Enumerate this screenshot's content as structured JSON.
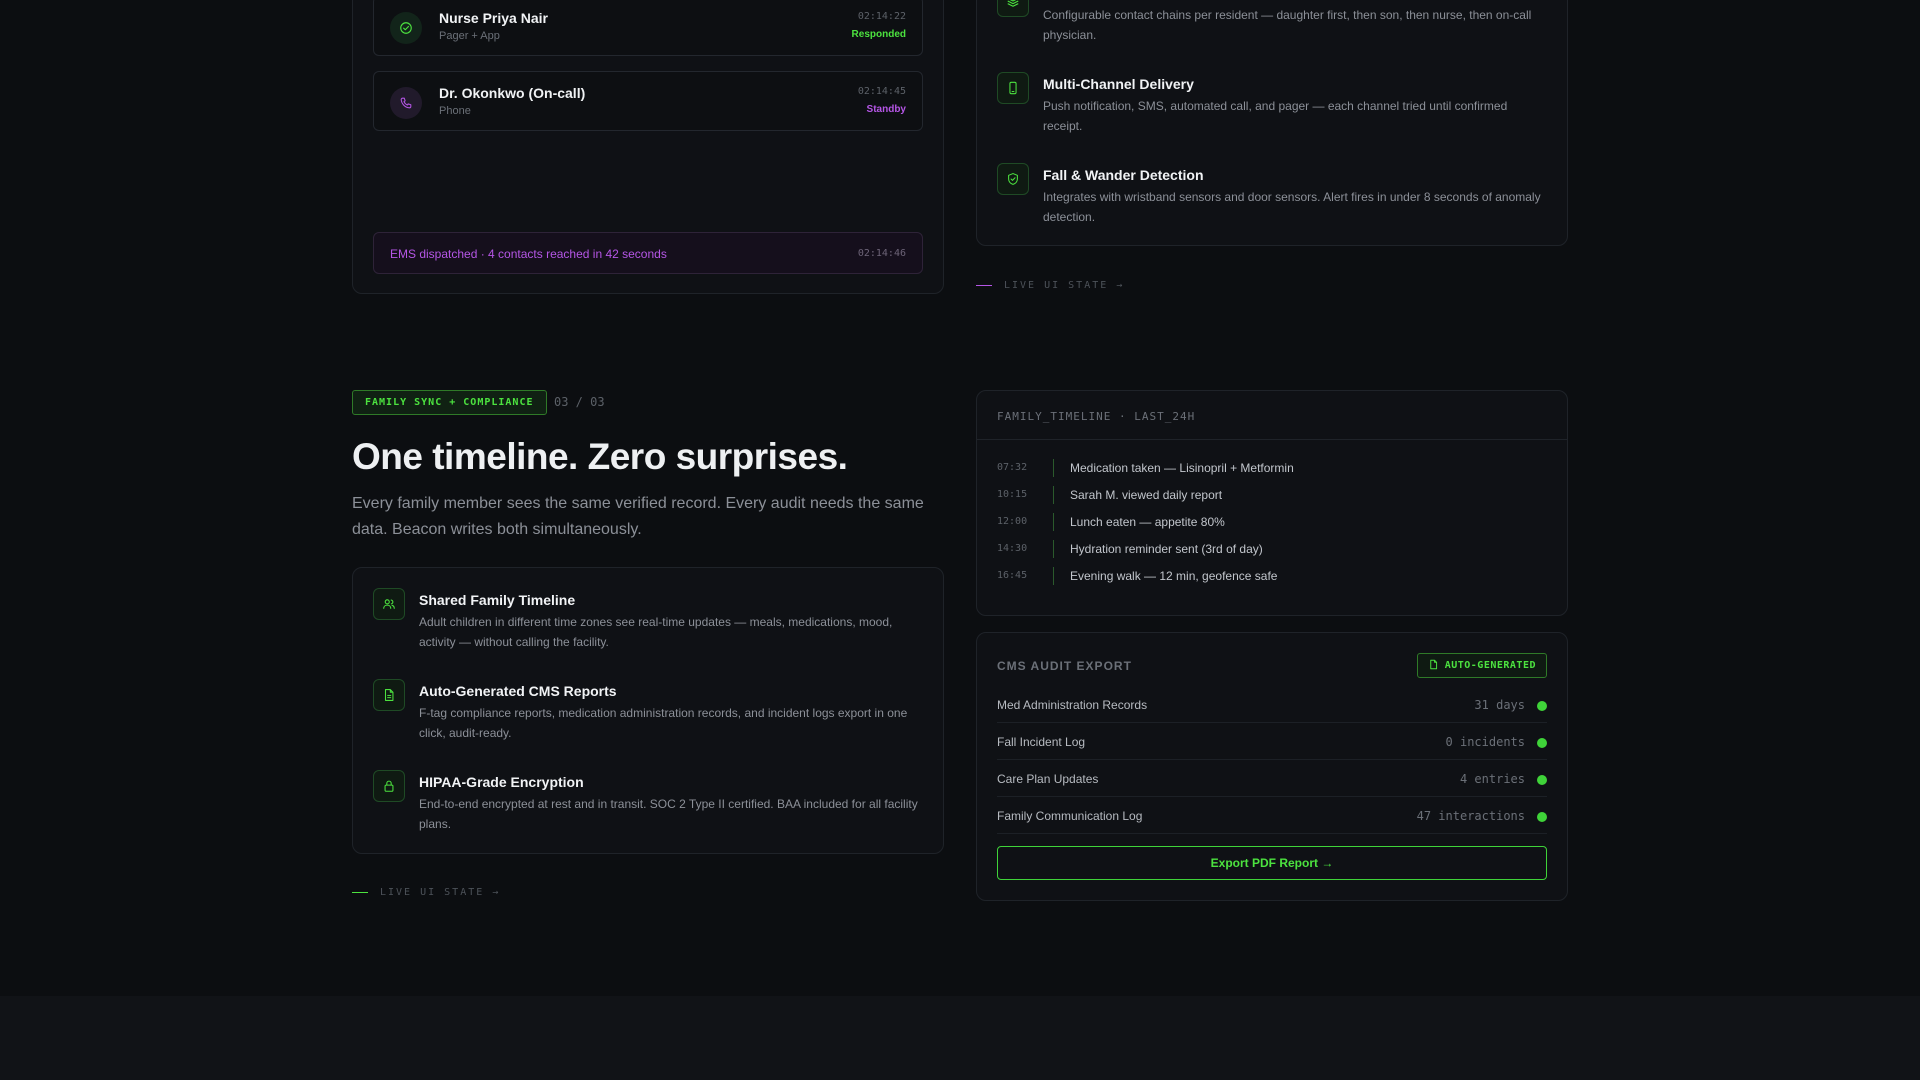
{
  "colors": {
    "accent_green": "#4ce23f",
    "accent_purple": "#b556e6",
    "background": "#0c0e11",
    "card": "#0f1115"
  },
  "escalation": {
    "contacts": [
      {
        "name": "Nurse Priya Nair",
        "channel": "Pager + App",
        "time": "02:14:22",
        "status": "Responded",
        "status_color": "#4ce23f",
        "icon": "check-circle-icon"
      },
      {
        "name": "Dr. Okonkwo (On-call)",
        "channel": "Phone",
        "time": "02:14:45",
        "status": "Standby",
        "status_color": "#b556e6",
        "icon": "phone-icon"
      }
    ],
    "ems_banner": {
      "text": "EMS dispatched · 4 contacts reached in 42 seconds",
      "time": "02:14:46"
    }
  },
  "routing_features": [
    {
      "title": "",
      "description": "Configurable contact chains per resident — daughter first, then son, then nurse, then on-call physician.",
      "icon": "layers-icon"
    },
    {
      "title": "Multi-Channel Delivery",
      "description": "Push notification, SMS, automated call, and pager — each channel tried until confirmed receipt.",
      "icon": "smartphone-icon"
    },
    {
      "title": "Fall & Wander Detection",
      "description": "Integrates with wristband sensors and door sensors. Alert fires in under 8 seconds of anomaly detection.",
      "icon": "shield-icon"
    }
  ],
  "live_state_label": "LIVE UI STATE →",
  "family_section": {
    "tag": "FAMILY SYNC + COMPLIANCE",
    "counter": "03 / 03",
    "headline": "One timeline. Zero surprises.",
    "subline": "Every family member sees the same verified record. Every audit needs the same data. Beacon writes both simultaneously.",
    "features": [
      {
        "title": "Shared Family Timeline",
        "description": "Adult children in different time zones see real-time updates — meals, medications, mood, activity — without calling the facility.",
        "icon": "users-icon"
      },
      {
        "title": "Auto-Generated CMS Reports",
        "description": "F-tag compliance reports, medication administration records, and incident logs export in one click, audit-ready.",
        "icon": "file-text-icon"
      },
      {
        "title": "HIPAA-Grade Encryption",
        "description": "End-to-end encrypted at rest and in transit. SOC 2 Type II certified. BAA included for all facility plans.",
        "icon": "lock-icon"
      }
    ]
  },
  "timeline": {
    "header": "FAMILY_TIMELINE · LAST_24H",
    "events": [
      {
        "time": "07:32",
        "event": "Medication taken — Lisinopril + Metformin"
      },
      {
        "time": "10:15",
        "event": "Sarah M. viewed daily report"
      },
      {
        "time": "12:00",
        "event": "Lunch eaten — appetite 80%"
      },
      {
        "time": "14:30",
        "event": "Hydration reminder sent (3rd of day)"
      },
      {
        "time": "16:45",
        "event": "Evening walk — 12 min, geofence safe"
      }
    ]
  },
  "audit": {
    "title": "CMS AUDIT EXPORT",
    "badge": "AUTO-GENERATED",
    "rows": [
      {
        "name": "Med Administration Records",
        "value": "31 days"
      },
      {
        "name": "Fall Incident Log",
        "value": "0 incidents"
      },
      {
        "name": "Care Plan Updates",
        "value": "4 entries"
      },
      {
        "name": "Family Communication Log",
        "value": "47 interactions"
      }
    ],
    "export_label": "Export PDF Report →"
  }
}
